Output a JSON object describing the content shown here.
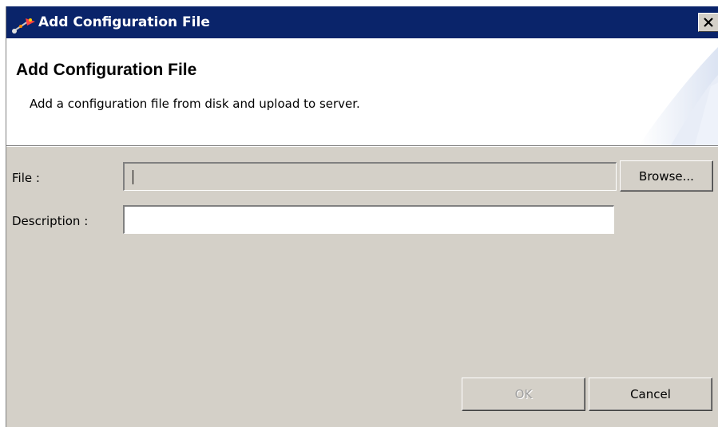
{
  "window": {
    "title": "Add Configuration File",
    "close_glyph": "✕",
    "icon": "app-wizard-icon"
  },
  "header": {
    "title": "Add Configuration File",
    "description": "Add a configuration file from disk and upload to server."
  },
  "form": {
    "file_label": "File :",
    "file_value": "",
    "file_enabled": false,
    "browse_label": "Browse...",
    "description_label": "Description :",
    "description_value": ""
  },
  "footer": {
    "ok_label": "OK",
    "ok_enabled": false,
    "cancel_label": "Cancel"
  },
  "colors": {
    "titlebar": "#0a246a",
    "dialog_bg": "#d4d0c8",
    "header_bg": "#ffffff",
    "deco_accent": "#dfe6f5"
  }
}
